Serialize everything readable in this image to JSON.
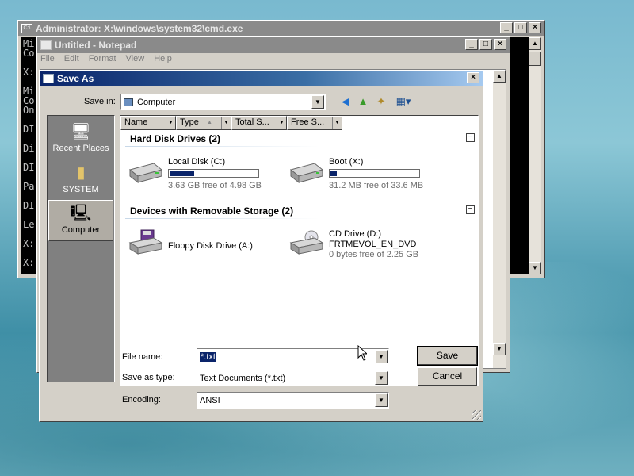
{
  "cmd": {
    "title": "Administrator: X:\\windows\\system32\\cmd.exe",
    "icon_text": "C:\\",
    "lines": [
      "Mi",
      "Co",
      "",
      "X:",
      "",
      "Mi",
      "Co",
      "On",
      "",
      "DI",
      "",
      "Di",
      "",
      "DI",
      "",
      "Pa",
      "",
      "DI",
      "",
      "Le",
      "",
      "X:",
      "",
      "X:"
    ],
    "buttons": {
      "minimize": "_",
      "maximize": "□",
      "close": "×"
    }
  },
  "notepad": {
    "title": "Untitled - Notepad",
    "menu": [
      "File",
      "Edit",
      "Format",
      "View",
      "Help"
    ],
    "buttons": {
      "minimize": "_",
      "maximize": "□",
      "close": "×"
    }
  },
  "saveas": {
    "title": "Save As",
    "close": "×",
    "save_in_label": "Save in:",
    "save_in_value": "Computer",
    "places": [
      {
        "label": "Recent Places",
        "icon": "recent-places-icon"
      },
      {
        "label": "SYSTEM",
        "icon": "folder-icon"
      },
      {
        "label": "Computer",
        "icon": "computer-icon",
        "selected": true
      }
    ],
    "columns": [
      "Name",
      "Type",
      "Total S...",
      "Free S..."
    ],
    "groups": [
      {
        "title": "Hard Disk Drives (2)",
        "drives": [
          {
            "name": "Local Disk (C:)",
            "free": "3.63 GB free of 4.98 GB",
            "used_fraction": 0.27
          },
          {
            "name": "Boot (X:)",
            "free": "31.2 MB free of 33.6 MB",
            "used_fraction": 0.07
          }
        ]
      },
      {
        "title": "Devices with Removable Storage (2)",
        "drives": [
          {
            "name": "Floppy Disk Drive (A:)"
          },
          {
            "name": "CD Drive (D:)",
            "label": "FRTMEVOL_EN_DVD",
            "free": "0 bytes free of 2.25 GB"
          }
        ]
      }
    ],
    "collapse_symbol": "−",
    "file_name_label": "File name:",
    "file_name_value": "*.txt",
    "type_label": "Save as type:",
    "type_value": "Text Documents (*.txt)",
    "encoding_label": "Encoding:",
    "encoding_value": "ANSI",
    "save_button": "Save",
    "cancel_button": "Cancel",
    "dropdown_arrow": "▼"
  }
}
